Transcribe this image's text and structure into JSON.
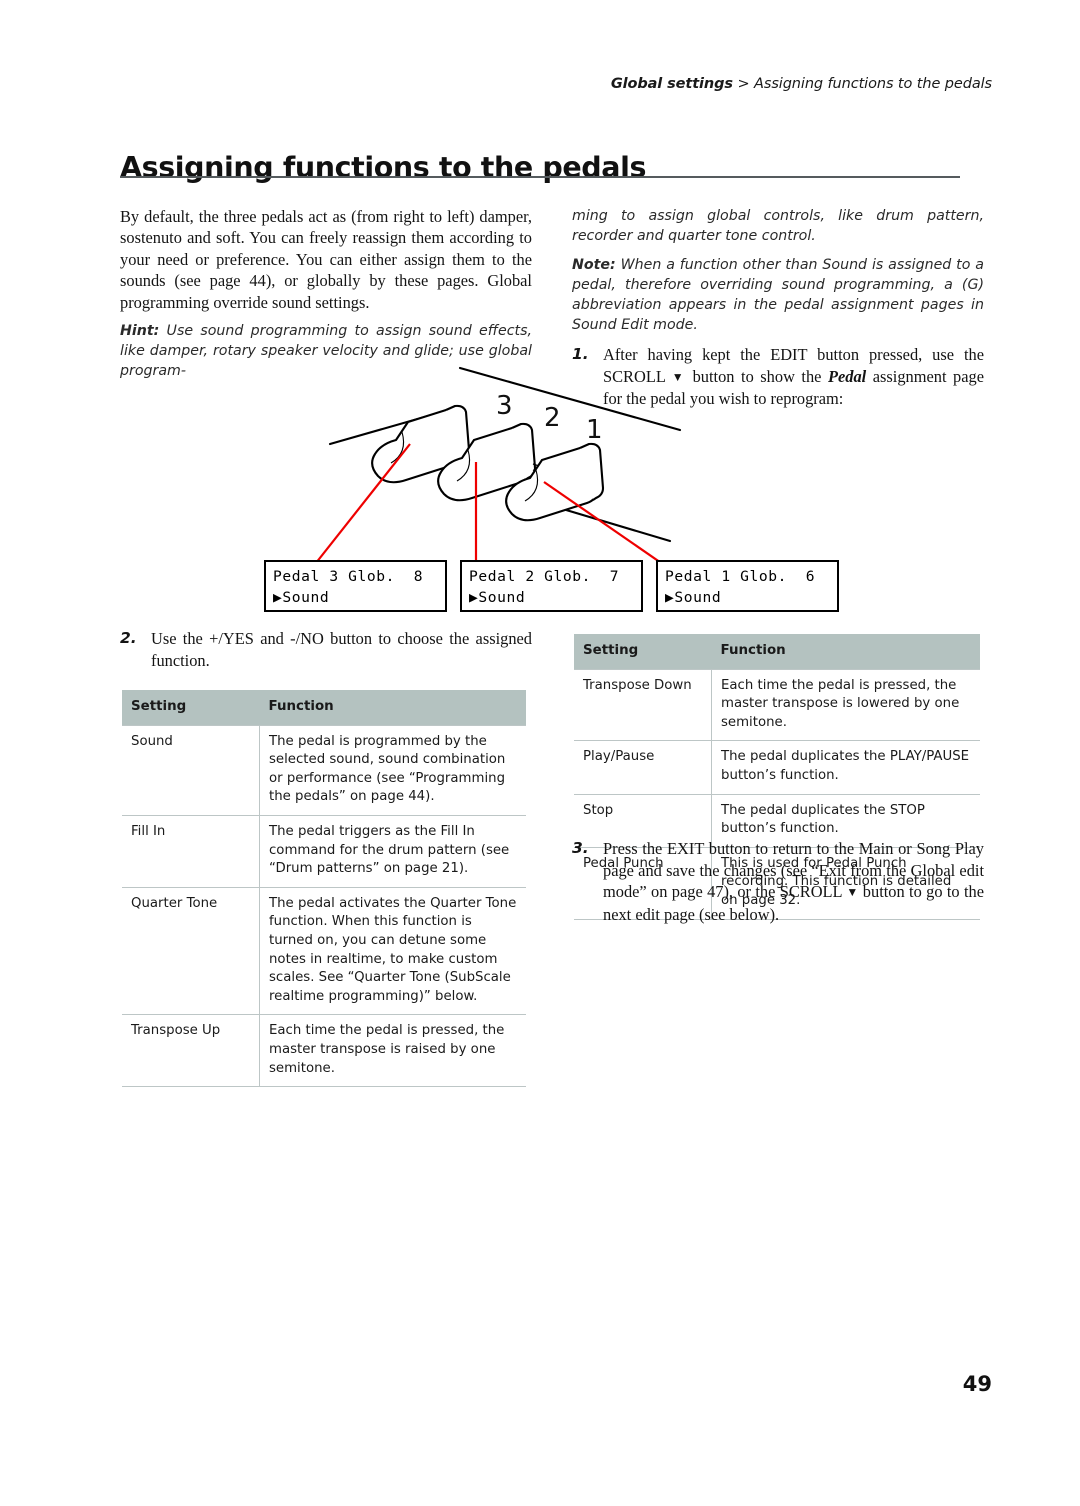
{
  "header": {
    "section": "Global settings",
    "separator": " > ",
    "topic": "Assigning functions to the pedals"
  },
  "title": "Assigning functions to the pedals",
  "folio": "49",
  "left_column": {
    "intro": "By default, the three pedals act as (from right to left) damper, sostenuto and soft. You can freely reassign them according to your need or preference. You can either assign them to the sounds (see page 44), or globally by these pages. Global programming override sound settings.",
    "hint_label": "Hint:",
    "hint_text": " Use sound programming to assign sound effects, like damper, rotary speaker velocity and glide; use global program-"
  },
  "right_column": {
    "hint_cont": "ming to assign global controls, like drum pattern, recorder and quarter tone control.",
    "note_label": "Note:",
    "note_text": " When a function other than Sound is assigned to a pedal, therefore overriding sound programming, a (G) abbreviation appears in the pedal assignment pages in Sound Edit mode."
  },
  "steps": {
    "one": {
      "num": "1.",
      "part_a": "After having kept the EDIT button pressed, use the SCROLL ",
      "arrow": "▼",
      "part_b": " button to show the ",
      "emphasis": "Pedal",
      "part_c": " assignment page for the pedal you wish to reprogram:"
    },
    "two": {
      "num": "2.",
      "text": "Use the +/YES and -/NO button to choose the assigned function."
    },
    "three": {
      "num": "3.",
      "part_a": "Press the EXIT button to return to the Main or Song Play page and save the changes (see “Exit from the Global edit mode” on page 47), or the SCROLL ",
      "arrow": "▼",
      "part_b": " button to go to the next edit page (see below)."
    }
  },
  "diagram": {
    "pedal_labels": [
      "3",
      "2",
      "1"
    ],
    "leader_color": "#ee0000"
  },
  "lcd_displays": [
    {
      "line1": "Pedal 3 Glob.  8",
      "line2": "▶Sound"
    },
    {
      "line1": "Pedal 2 Glob.  7",
      "line2": "▶Sound"
    },
    {
      "line1": "Pedal 1 Glob.  6",
      "line2": "▶Sound"
    }
  ],
  "table_left": {
    "headers": [
      "Setting",
      "Function"
    ],
    "rows": [
      {
        "setting": "Sound",
        "function": "The pedal is programmed by the selected sound, sound combination or performance (see “Programming the pedals” on page 44)."
      },
      {
        "setting": "Fill In",
        "function": "The pedal triggers as the Fill In command for the drum pattern (see “Drum patterns” on page 21)."
      },
      {
        "setting": "Quarter Tone",
        "function": "The pedal activates the Quarter Tone function. When this function is turned on, you can detune some notes in realtime, to make custom scales. See “Quarter Tone (SubScale realtime programming)” below."
      },
      {
        "setting": "Transpose Up",
        "function": "Each time the pedal is pressed, the master transpose is raised by one semitone."
      }
    ]
  },
  "table_right": {
    "headers": [
      "Setting",
      "Function"
    ],
    "rows": [
      {
        "setting": "Transpose Down",
        "function": "Each time the pedal is pressed, the master transpose is lowered by one semitone."
      },
      {
        "setting": "Play/Pause",
        "function": "The pedal duplicates the PLAY/PAUSE button’s function."
      },
      {
        "setting": "Stop",
        "function": "The pedal duplicates the STOP button’s function."
      },
      {
        "setting": "Pedal Punch",
        "function": "This is used for Pedal Punch recording. This function is detailed on page 32."
      }
    ]
  },
  "colors": {
    "table_header_bg": "#b4c2c0",
    "rule": "#555b5e",
    "leader_line": "#ee0000"
  }
}
